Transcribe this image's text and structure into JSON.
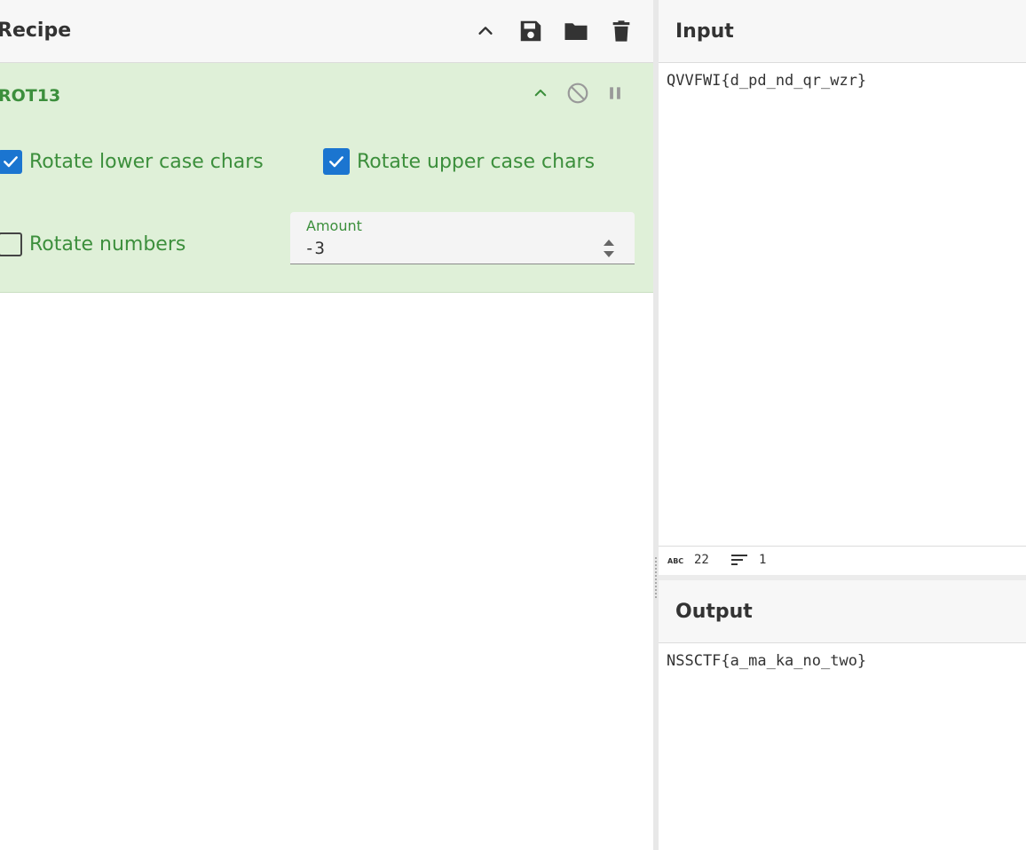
{
  "recipe": {
    "title": "Recipe",
    "header_icons": [
      "chevron-up-icon",
      "save-icon",
      "folder-icon",
      "trash-icon"
    ]
  },
  "operation": {
    "name": "ROT13",
    "icons": [
      "chevron-up-icon",
      "disable-icon",
      "pause-icon"
    ],
    "options": {
      "rotate_lower": {
        "label": "Rotate lower case chars",
        "checked": true
      },
      "rotate_upper": {
        "label": "Rotate upper case chars",
        "checked": true
      },
      "rotate_numbers": {
        "label": "Rotate numbers",
        "checked": false
      }
    },
    "amount": {
      "label": "Amount",
      "value": "-3"
    }
  },
  "input": {
    "title": "Input",
    "text": "QVVFWI{d_pd_nd_qr_wzr}",
    "status": {
      "char_count": "22",
      "line_count": "1"
    }
  },
  "output": {
    "title": "Output",
    "text": "NSSCTF{a_ma_ka_no_two}"
  },
  "colors": {
    "operation_bg": "#dff0d8",
    "operation_text": "#3c8f3c",
    "checkbox_checked": "#1b75d0"
  }
}
